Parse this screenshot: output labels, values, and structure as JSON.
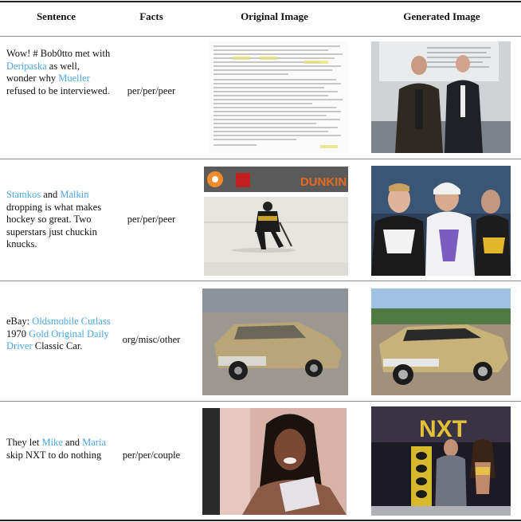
{
  "headers": {
    "sentence": "Sentence",
    "facts": "Facts",
    "original": "Original Image",
    "generated": "Generated Image"
  },
  "rows": [
    {
      "sentence": {
        "p1": "Wow! # Bob0tto met with",
        "e1": "Deripaska",
        "p2": "as well, wonder why",
        "e2": "Mueller",
        "p3": "refused to be interviewed."
      },
      "facts": "per/per/peer"
    },
    {
      "sentence": {
        "e1": "Stamkos",
        "p1": "and",
        "e2": "Malkin",
        "p2": "dropping is what makes hockey so great. Two superstars just chuckin knucks."
      },
      "facts": "per/per/peer",
      "original_image_text": "DUNKIN"
    },
    {
      "sentence": {
        "p1": "eBay:",
        "e1": "Oldsmobile Cutlass",
        "p2": "1970",
        "e2": "Gold Original Daily Driver",
        "p3": "Classic Car."
      },
      "facts": "org/misc/other"
    },
    {
      "sentence": {
        "p1": "They let",
        "e1": "Mike",
        "p2": "and",
        "e2": "Maria",
        "p3": "skip NXT to do nothing"
      },
      "facts": "per/per/couple",
      "generated_image_text": "NXT"
    }
  ],
  "colors": {
    "entity": "#4aa6e0",
    "rule": "#222222",
    "inner_rule": "#8a8a8a"
  }
}
